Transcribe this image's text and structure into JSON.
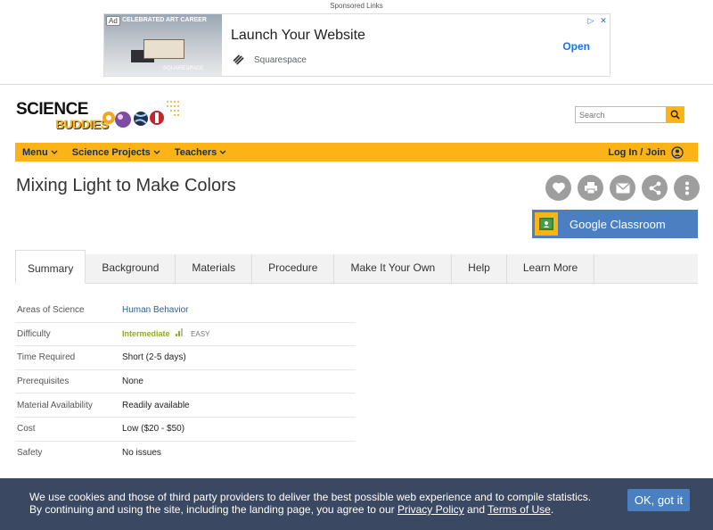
{
  "ad": {
    "sponsored_label": "Sponsored Links",
    "badge": "Ad",
    "image_caption": "CELEBRATED ART CAREER",
    "image_brand": "SQUARESPACE",
    "headline": "Launch Your Website",
    "advertiser": "Squarespace",
    "cta": "Open"
  },
  "header": {
    "logo_line1": "SCIENCE",
    "logo_line2": "BUDDIES",
    "search_placeholder": "Search"
  },
  "nav": {
    "items": [
      "Menu",
      "Science Projects",
      "Teachers"
    ],
    "login": "Log In / Join"
  },
  "page": {
    "title": "Mixing Light to Make Colors",
    "action_icons": [
      "heart-icon",
      "print-icon",
      "mail-icon",
      "share-icon",
      "more-icon"
    ],
    "google_classroom": "Google Classroom"
  },
  "tabs": [
    "Summary",
    "Background",
    "Materials",
    "Procedure",
    "Make It Your Own",
    "Help",
    "Learn More"
  ],
  "active_tab": "Summary",
  "summary": {
    "rows": [
      {
        "label": "Areas of Science",
        "value": "Human Behavior"
      },
      {
        "label": "Difficulty",
        "value": "Intermediate",
        "extra": "EASY"
      },
      {
        "label": "Time Required",
        "value": "Short (2-5 days)"
      },
      {
        "label": "Prerequisites",
        "value": "None"
      },
      {
        "label": "Material Availability",
        "value": "Readily available"
      },
      {
        "label": "Cost",
        "value": "Low ($20 - $50)"
      },
      {
        "label": "Safety",
        "value": "No issues"
      }
    ]
  },
  "cookie": {
    "line1": "We use cookies and those of third party providers to deliver the best possible web experience and to compile statistics.",
    "line2_prefix": "By continuing and using the site, including the landing page, you agree to our ",
    "privacy_link": "Privacy Policy",
    "and": " and ",
    "terms_link": "Terms of Use",
    "period": ".",
    "button": "OK, got it"
  },
  "colors": {
    "brand_yellow": "#fcb316",
    "nav_text": "#1b2d4f",
    "classroom_blue": "#4a7fc1",
    "cookie_bg": "#2c3a56",
    "difficulty_green": "#8eab2b"
  }
}
